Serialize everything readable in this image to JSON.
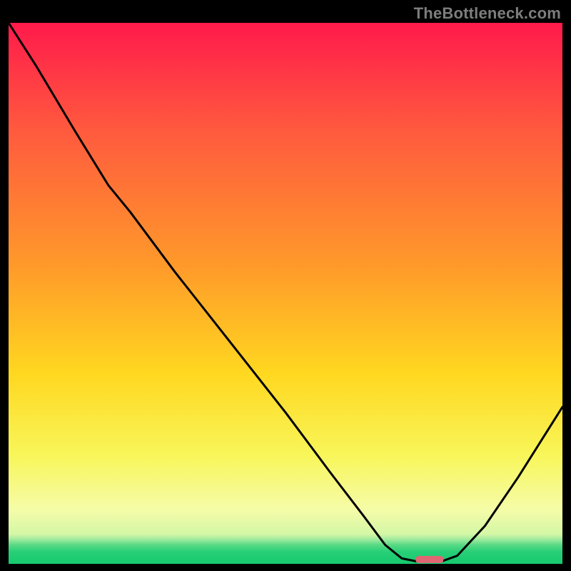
{
  "watermark": "TheBottleneck.com",
  "chart_data": {
    "type": "line",
    "title": "",
    "xlabel": "",
    "ylabel": "",
    "xlim": [
      0,
      100
    ],
    "ylim": [
      0,
      100
    ],
    "grid": false,
    "legend": false,
    "gradient_stops": [
      {
        "t": 0.0,
        "color": "#ff1a4b"
      },
      {
        "t": 0.2,
        "color": "#ff5a3e"
      },
      {
        "t": 0.45,
        "color": "#ff9a2a"
      },
      {
        "t": 0.65,
        "color": "#ffd820"
      },
      {
        "t": 0.8,
        "color": "#f8f65a"
      },
      {
        "t": 0.9,
        "color": "#f5fca8"
      },
      {
        "t": 0.945,
        "color": "#d4f7a6"
      },
      {
        "t": 0.955,
        "color": "#9eea9e"
      },
      {
        "t": 0.965,
        "color": "#59d985"
      },
      {
        "t": 0.978,
        "color": "#27cf77"
      },
      {
        "t": 1.0,
        "color": "#16c96e"
      }
    ],
    "curve_points": [
      {
        "x": 0.0,
        "y": 100.0
      },
      {
        "x": 5.0,
        "y": 92.0
      },
      {
        "x": 12.0,
        "y": 80.0
      },
      {
        "x": 18.0,
        "y": 70.0
      },
      {
        "x": 22.0,
        "y": 65.0
      },
      {
        "x": 30.0,
        "y": 54.0
      },
      {
        "x": 40.0,
        "y": 41.0
      },
      {
        "x": 50.0,
        "y": 28.0
      },
      {
        "x": 58.0,
        "y": 17.0
      },
      {
        "x": 64.0,
        "y": 9.0
      },
      {
        "x": 68.0,
        "y": 3.5
      },
      {
        "x": 71.0,
        "y": 1.0
      },
      {
        "x": 74.0,
        "y": 0.4
      },
      {
        "x": 78.0,
        "y": 0.4
      },
      {
        "x": 81.0,
        "y": 1.5
      },
      {
        "x": 86.0,
        "y": 7.0
      },
      {
        "x": 92.0,
        "y": 16.0
      },
      {
        "x": 100.0,
        "y": 29.0
      }
    ],
    "sweet_spot": {
      "x_start": 73.5,
      "x_end": 78.5,
      "y": 0.8
    },
    "marker_color": "#e06673",
    "line_color": "#000000",
    "line_width": 3
  }
}
